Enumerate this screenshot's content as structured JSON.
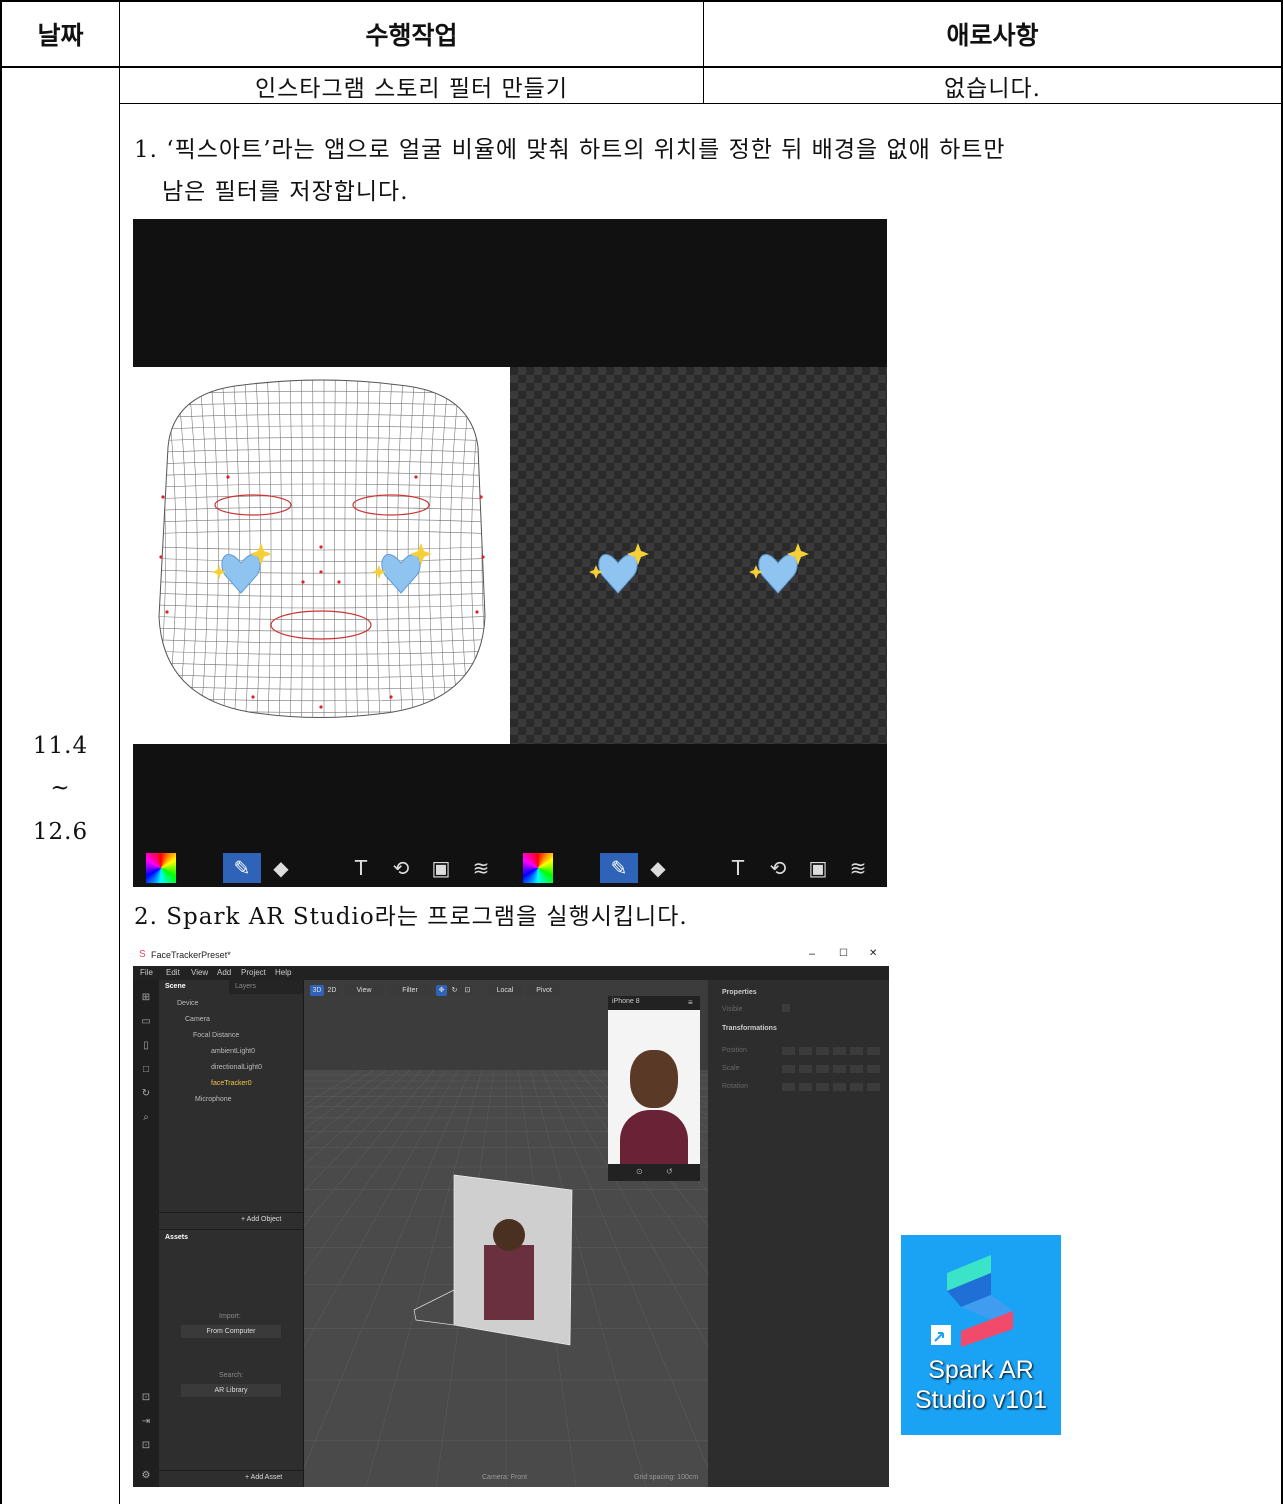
{
  "table": {
    "headers": [
      "날짜",
      "수행작업",
      "애로사항"
    ],
    "date": {
      "start": "11.4",
      "sep": "~",
      "end": "12.6"
    },
    "task": "인스타그램 스토리 필터 만들기",
    "issue": "없습니다."
  },
  "steps": [
    {
      "line1": "1. ‘픽스아트’라는 앱으로 얼굴 비율에 맞춰 하트의 위치를 정한 뒤 배경을 없애 하트만",
      "line2": "남은 필터를 저장합니다."
    },
    {
      "line1": "2. Spark AR Studio라는 프로그램을 실행시킵니다."
    }
  ],
  "filter_image": {
    "toolbar_icons": [
      "color-palette-icon",
      "brush-icon",
      "eraser-icon",
      "text-icon",
      "sticker-icon",
      "image-icon",
      "layers-icon"
    ]
  },
  "spark": {
    "window_title": "FaceTrackerPreset*",
    "window_controls": {
      "minimize": "–",
      "maximize": "☐",
      "close": "✕"
    },
    "menu": [
      "File",
      "Edit",
      "View",
      "Add",
      "Project",
      "Help"
    ],
    "scene_tabs": [
      "Scene",
      "Layers"
    ],
    "tree": [
      "Device",
      "Camera",
      "Focal Distance",
      "ambientLight0",
      "directionalLight0",
      "faceTracker0",
      "Microphone"
    ],
    "add_object": "+ Add Object",
    "assets_title": "Assets",
    "import_label": "Import:",
    "from_computer": "From Computer",
    "search_label": "Search:",
    "ar_library": "AR Library",
    "add_asset": "+ Add Asset",
    "view_toolbar": [
      "3D",
      "2D",
      "View",
      "Filter",
      "Local",
      "Pivot"
    ],
    "device": "iPhone 8",
    "camera_label": "Camera: Front",
    "grid_spacing": "Grid spacing: 100cm",
    "properties_title": "Properties",
    "visible_label": "Visible",
    "transformations_title": "Transformations",
    "transform_rows": [
      "Position",
      "Scale",
      "Rotation"
    ]
  },
  "spark_icon": {
    "line1": "Spark AR",
    "line2": "Studio v101"
  },
  "colors": {
    "spark_bg": "#1aa3f5",
    "highlight": "#f2c744",
    "select_blue": "#2f63b8"
  }
}
